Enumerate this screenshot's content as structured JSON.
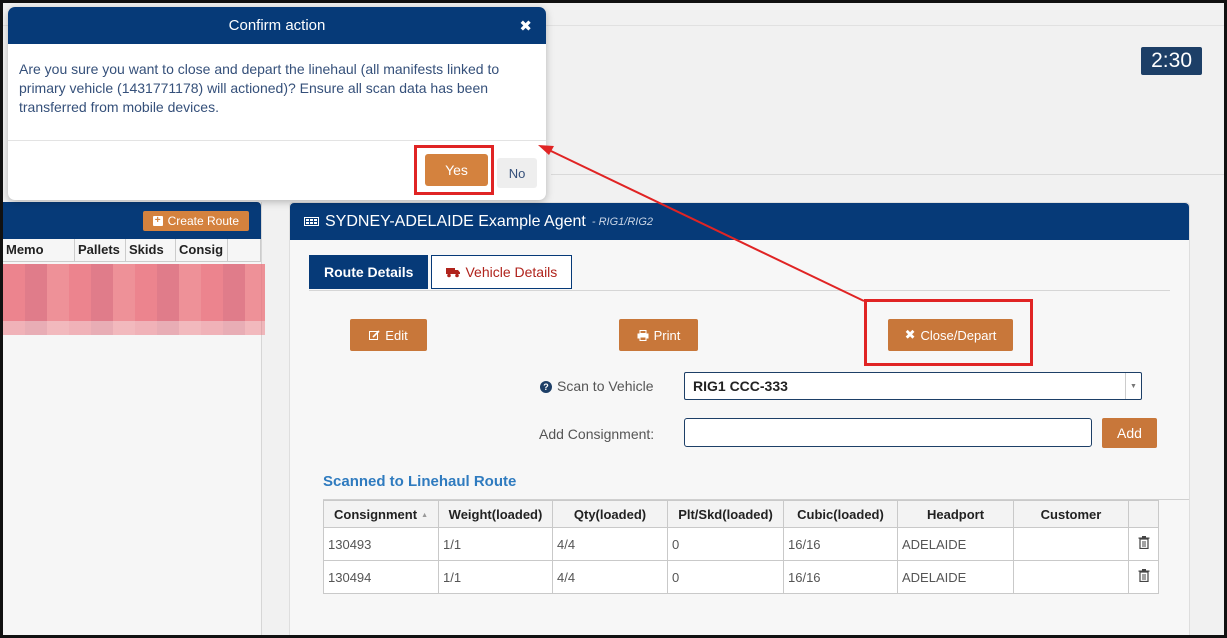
{
  "timer": "2:30",
  "left_panel": {
    "create_route_label": "Create Route",
    "columns": [
      "Memo",
      "Pallets",
      "Skids",
      "Consig"
    ]
  },
  "main_panel": {
    "title": "SYDNEY-ADELAIDE Example Agent",
    "subtitle": "- RIG1/RIG2",
    "tabs": [
      {
        "label": "Route Details",
        "active": true
      },
      {
        "label": "Vehicle Details",
        "active": false
      }
    ],
    "buttons": {
      "edit": "Edit",
      "print": "Print",
      "close_depart": "Close/Depart",
      "add": "Add"
    },
    "scan_to_vehicle_label": "Scan to Vehicle",
    "scan_to_vehicle_value": "RIG1 CCC-333",
    "add_consignment_label": "Add Consignment:",
    "add_consignment_value": ""
  },
  "scanned_section": {
    "title": "Scanned to Linehaul Route",
    "columns": [
      "Consignment",
      "Weight(loaded)",
      "Qty(loaded)",
      "Plt/Skd(loaded)",
      "Cubic(loaded)",
      "Headport",
      "Customer"
    ],
    "rows": [
      {
        "consignment": "130493",
        "weight": "1/1",
        "qty": "4/4",
        "plt_skd": "0",
        "cubic": "16/16",
        "headport": "ADELAIDE",
        "customer": ""
      },
      {
        "consignment": "130494",
        "weight": "1/1",
        "qty": "4/4",
        "plt_skd": "0",
        "cubic": "16/16",
        "headport": "ADELAIDE",
        "customer": ""
      }
    ]
  },
  "modal": {
    "title": "Confirm action",
    "message": "Are you sure you want to close and depart the linehaul (all manifests linked to primary vehicle (1431771178) will actioned)? Ensure all scan data has been transferred from mobile devices.",
    "yes_label": "Yes",
    "no_label": "No"
  },
  "colors": {
    "header_navy": "#063a78",
    "accent_orange": "#d4823e",
    "highlight_red": "#e02424",
    "section_blue": "#2f7bbf"
  },
  "icons": [
    "close-icon",
    "plus-square-icon",
    "table-grid-icon",
    "truck-icon",
    "edit-icon",
    "print-icon",
    "x-icon",
    "question-circle-icon",
    "trash-icon",
    "sort-icon",
    "dropdown-arrow-icon"
  ]
}
